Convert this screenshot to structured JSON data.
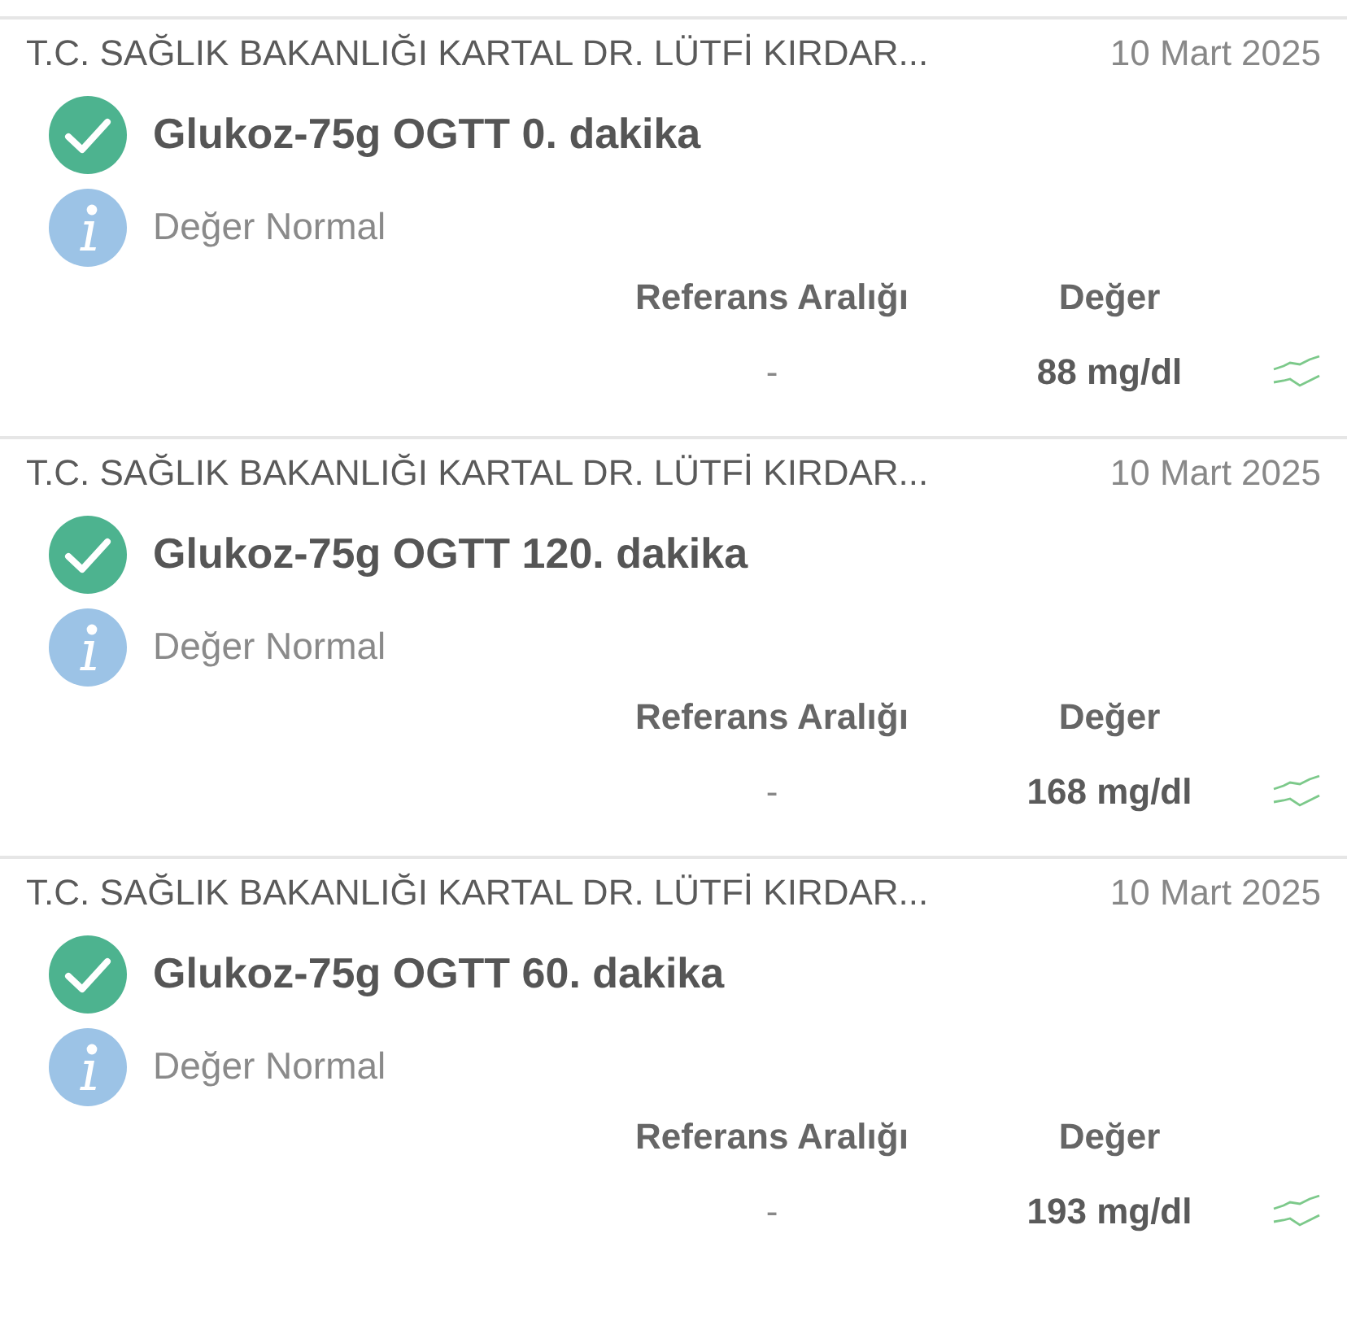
{
  "results": [
    {
      "lab": "T.C. SAĞLIK BAKANLIĞI KARTAL DR. LÜTFİ KIRDAR...",
      "date": "10 Mart 2025",
      "verified": true,
      "test": "Glukoz-75g OGTT 0. dakika",
      "note": "Değer Normal",
      "reference_label": "Referans Aralığı",
      "value_label": "Değer",
      "reference": "-",
      "value": "88 mg/dl"
    },
    {
      "lab": "T.C. SAĞLIK BAKANLIĞI KARTAL DR. LÜTFİ KIRDAR...",
      "date": "10 Mart 2025",
      "verified": true,
      "test": "Glukoz-75g OGTT 120. dakika",
      "note": "Değer Normal",
      "reference_label": "Referans Aralığı",
      "value_label": "Değer",
      "reference": "-",
      "value": "168 mg/dl"
    },
    {
      "lab": "T.C. SAĞLIK BAKANLIĞI KARTAL DR. LÜTFİ KIRDAR...",
      "date": "10 Mart 2025",
      "verified": true,
      "test": "Glukoz-75g OGTT 60. dakika",
      "note": "Değer Normal",
      "reference_label": "Referans Aralığı",
      "value_label": "Değer",
      "reference": "-",
      "value": "193 mg/dl"
    }
  ]
}
